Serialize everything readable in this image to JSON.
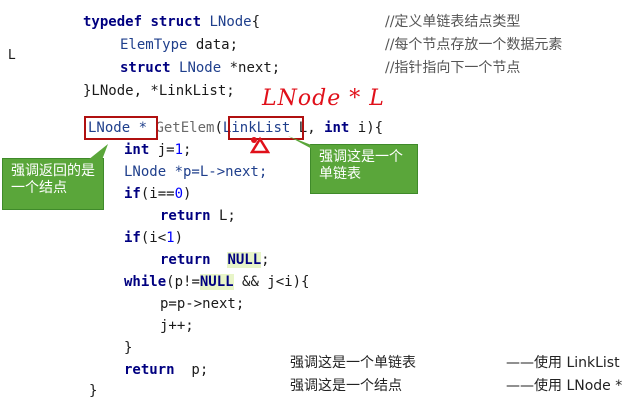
{
  "margin_marker": "L",
  "code": {
    "line1": {
      "kw1": "typedef",
      "kw2": "struct",
      "type": "LNode",
      "brace": "{",
      "comment": "//定义单链表结点类型"
    },
    "line2": {
      "type": "ElemType",
      "rest": " data;",
      "comment": "//每个节点存放一个数据元素"
    },
    "line3": {
      "kw": "struct",
      "type": "LNode",
      "rest": " *next;",
      "comment": "//指针指向下一个节点"
    },
    "line4": {
      "text": "}LNode, *LinkList;"
    },
    "line5": {
      "ret": "LNode *",
      "fn": "GetElem",
      "open": "(",
      "param_type": "LinkList",
      "rest1": " L, ",
      "kw": "int",
      "rest2": " i){"
    },
    "line6": {
      "kw": "int",
      "rest": " j=",
      "num": "1",
      "end": ";"
    },
    "line7": {
      "text": "LNode *p=L->next;"
    },
    "line8": {
      "kw": "if",
      "rest": "(i==",
      "num": "0",
      "end": ")"
    },
    "line9": {
      "kw": "return",
      "rest": " L;"
    },
    "line10": {
      "kw": "if",
      "rest": "(i<",
      "num": "1",
      "end": ")"
    },
    "line11": {
      "kw": "return",
      "null": "NULL",
      "end": ";"
    },
    "line12": {
      "kw": "while",
      "rest1": "(p!=",
      "null": "NULL",
      "rest2": " && j<i){"
    },
    "line13": {
      "text": "p=p->next;"
    },
    "line14": {
      "text": "j++;"
    },
    "line15": {
      "text": "}"
    },
    "line16": {
      "kw": "return",
      "rest": "  p;"
    },
    "line17": {
      "text": "}"
    }
  },
  "annotations": {
    "handwritten": "LNode * L",
    "callout_left": "强调返回的是一个结点",
    "callout_right": "强调这是一个单链表",
    "note1_left": "强调这是一个单链表",
    "note1_right": "——使用 LinkList",
    "note2_left": "强调这是一个结点",
    "note2_right": "——使用 LNode *"
  },
  "colors": {
    "box": "#b01010",
    "handwriting": "#e0101a",
    "callout": "#5aa63a"
  }
}
